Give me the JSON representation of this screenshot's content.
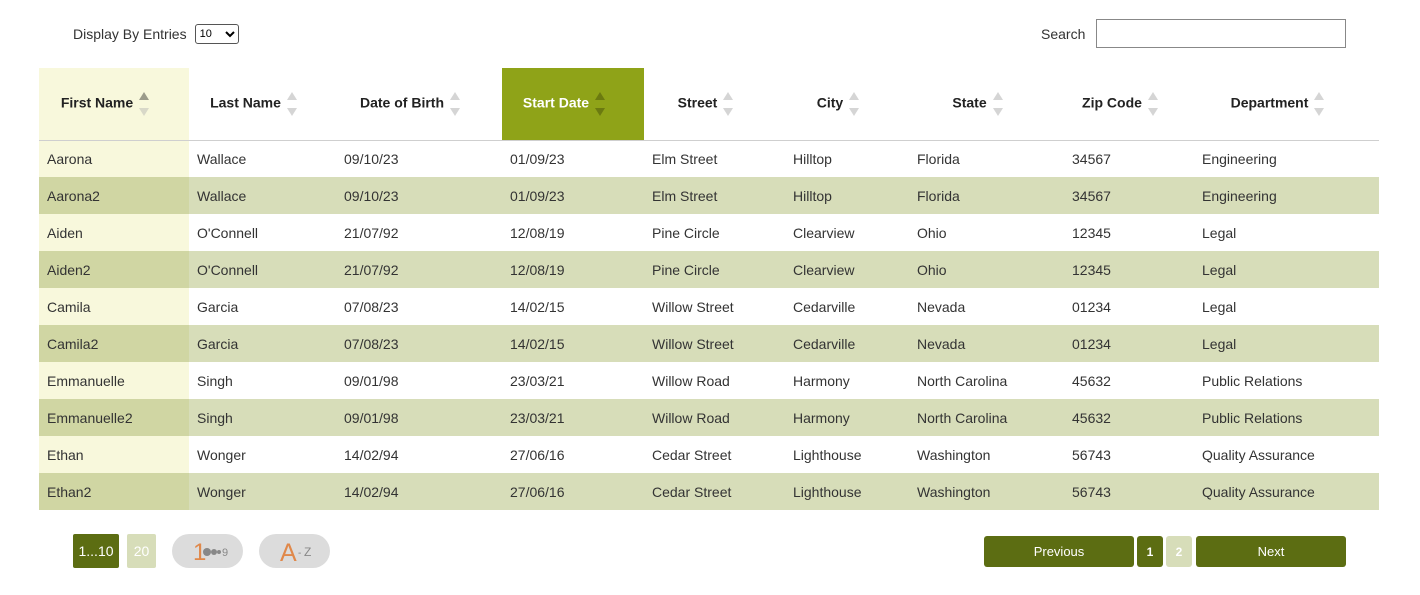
{
  "controls": {
    "entries_label": "Display By Entries",
    "entries_value": "10",
    "search_label": "Search",
    "search_value": ""
  },
  "table": {
    "columns": [
      "First Name",
      "Last Name",
      "Date of Birth",
      "Start Date",
      "Street",
      "City",
      "State",
      "Zip Code",
      "Department"
    ],
    "sorted_column": "First Name",
    "active_column": "Start Date",
    "rows": [
      [
        "Aarona",
        "Wallace",
        "09/10/23",
        "01/09/23",
        "Elm Street",
        "Hilltop",
        "Florida",
        "34567",
        "Engineering"
      ],
      [
        "Aarona2",
        "Wallace",
        "09/10/23",
        "01/09/23",
        "Elm Street",
        "Hilltop",
        "Florida",
        "34567",
        "Engineering"
      ],
      [
        "Aiden",
        "O'Connell",
        "21/07/92",
        "12/08/19",
        "Pine Circle",
        "Clearview",
        "Ohio",
        "12345",
        "Legal"
      ],
      [
        "Aiden2",
        "O'Connell",
        "21/07/92",
        "12/08/19",
        "Pine Circle",
        "Clearview",
        "Ohio",
        "12345",
        "Legal"
      ],
      [
        "Camila",
        "Garcia",
        "07/08/23",
        "14/02/15",
        "Willow Street",
        "Cedarville",
        "Nevada",
        "01234",
        "Legal"
      ],
      [
        "Camila2",
        "Garcia",
        "07/08/23",
        "14/02/15",
        "Willow Street",
        "Cedarville",
        "Nevada",
        "01234",
        "Legal"
      ],
      [
        "Emmanuelle",
        "Singh",
        "09/01/98",
        "23/03/21",
        "Willow Road",
        "Harmony",
        "North Carolina",
        "45632",
        "Public Relations"
      ],
      [
        "Emmanuelle2",
        "Singh",
        "09/01/98",
        "23/03/21",
        "Willow Road",
        "Harmony",
        "North Carolina",
        "45632",
        "Public Relations"
      ],
      [
        "Ethan",
        "Wonger",
        "14/02/94",
        "27/06/16",
        "Cedar Street",
        "Lighthouse",
        "Washington",
        "56743",
        "Quality Assurance"
      ],
      [
        "Ethan2",
        "Wonger",
        "14/02/94",
        "27/06/16",
        "Cedar Street",
        "Lighthouse",
        "Washington",
        "56743",
        "Quality Assurance"
      ]
    ]
  },
  "footer": {
    "page_size_a": "1...10",
    "page_size_b": "20",
    "numeric_sort_digit": "1",
    "numeric_sort_end": "9",
    "alpha_sort_start": "A",
    "alpha_sort_end": "Z",
    "previous_label": "Previous",
    "next_label": "Next",
    "pages": [
      "1",
      "2"
    ],
    "current_page": "1"
  },
  "colors": {
    "accent_dark": "#5c6d12",
    "accent_active": "#8fa318",
    "row_stripe": "#d7ddb9",
    "sorted_col": "#f8f8dc",
    "icon_orange": "#e0884a"
  }
}
